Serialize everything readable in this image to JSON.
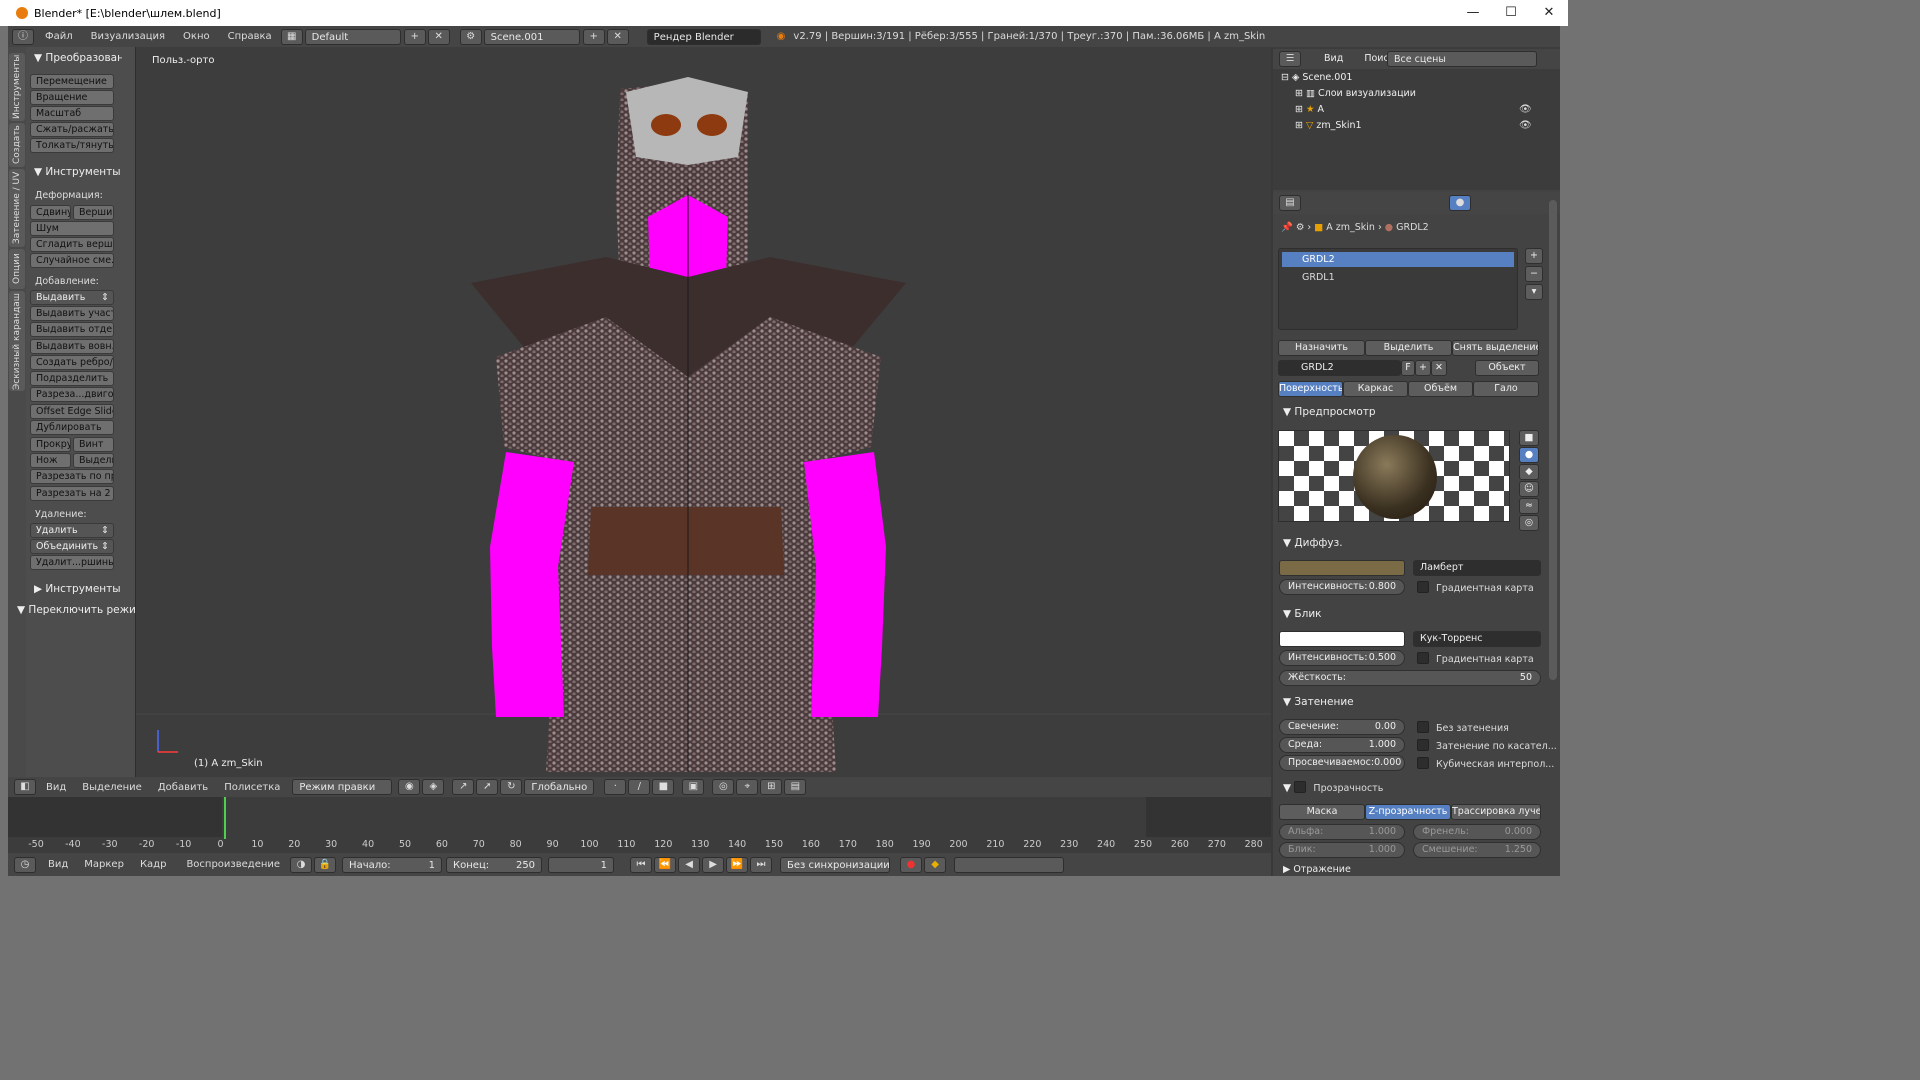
{
  "window": {
    "title": "Blender* [E:\\blender\\шлем.blend]",
    "buttons": [
      "—",
      "☐",
      "✕"
    ]
  },
  "topbar": {
    "menus": [
      "Файл",
      "Визуализация",
      "Окно",
      "Справка"
    ],
    "layout": "Default",
    "scene": "Scene.001",
    "engine": "Рендер Blender",
    "stats": "v2.79 | Вершин:3/191 | Рёбер:3/555 | Граней:1/370 | Треуг.:370 | Пам.:36.06МБ | A zm_Skin"
  },
  "vtabs": [
    "Инструменты",
    "Создать",
    "Затенение / UV",
    "Опции",
    "Эскизный карандаш"
  ],
  "toolshelf": {
    "transform_header": "Преобразовани",
    "transform": [
      "Перемещение",
      "Вращение",
      "Масштаб",
      "Сжать/расжать",
      "Толкать/тянуть"
    ],
    "mesh_tools_header": "Инструменты по",
    "deform_label": "Деформация:",
    "deform_row": [
      "Сдвину",
      "Вершин"
    ],
    "deform": [
      "Шум",
      "Сгладить верш...",
      "Случайное сме..."
    ],
    "add_label": "Добавление:",
    "extrude_dd": "Выдавить",
    "add": [
      "Выдавить участ...",
      "Выдавить отде...",
      "Выдавить вовн...",
      "Создать ребро/г...",
      "Подразделить",
      "Разреза...двигом",
      "Offset Edge Slide",
      "Дублировать"
    ],
    "row1": [
      "Прокру",
      "Винт"
    ],
    "row2": [
      "Нож",
      "Выдели"
    ],
    "cuts": [
      "Разрезать по пр...",
      "Разрезать на 2 ..."
    ],
    "remove_label": "Удаление:",
    "delete_dd": "Удалить",
    "merge_dd": "Объединить",
    "remove_doubles": "Удалит...ршины",
    "more_tools": "Инструменты ве",
    "toggle_mode": "Переключить режи п"
  },
  "viewport": {
    "view_label": "Польз.-орто",
    "object_label": "(1) A zm_Skin"
  },
  "viewport_footer": {
    "menus": [
      "Вид",
      "Выделение",
      "Добавить",
      "Полисетка"
    ],
    "mode": "Режим правки",
    "orientation": "Глобально"
  },
  "timeline": {
    "ticks": [
      "-50",
      "-40",
      "-30",
      "-20",
      "-10",
      "0",
      "10",
      "20",
      "30",
      "40",
      "50",
      "60",
      "70",
      "80",
      "90",
      "100",
      "110",
      "120",
      "130",
      "140",
      "150",
      "160",
      "170",
      "180",
      "190",
      "200",
      "210",
      "220",
      "230",
      "240",
      "250",
      "260",
      "270",
      "280"
    ],
    "current_frame": 1,
    "menus": [
      "Вид",
      "Маркер",
      "Кадр",
      "Воспроизведение"
    ],
    "start_label": "Начало:",
    "start": "1",
    "end_label": "Конец:",
    "end": "250",
    "frame": "1",
    "sync": "Без синхронизации"
  },
  "outliner": {
    "menus": [
      "Вид",
      "Поиск"
    ],
    "filter": "Все сцены",
    "rows": [
      "Scene.001",
      "Слои визуализации",
      "A",
      "zm_Skin1"
    ]
  },
  "properties": {
    "breadcrumb": [
      "A zm_Skin",
      "GRDL2"
    ],
    "slots": [
      "GRDL2",
      "GRDL1"
    ],
    "assign": "Назначить",
    "select": "Выделить",
    "deselect": "Снять выделение",
    "material_name": "GRDL2",
    "fake_user": "F",
    "link": "Объект",
    "tabs": [
      "Поверхность",
      "Каркас",
      "Объём",
      "Гало"
    ],
    "preview_header": "Предпросмотр",
    "diffuse_header": "Диффуз.",
    "diffuse_color": "#7a6a45",
    "diffuse_shader": "Ламберт",
    "intensity_label": "Интенсивность:",
    "diffuse_intensity": "0.800",
    "ramp_label": "Градиентная карта",
    "specular_header": "Блик",
    "specular_shader": "Кук-Торренс",
    "specular_intensity": "0.500",
    "hardness_label": "Жёсткость:",
    "hardness": "50",
    "shading_header": "Затенение",
    "emit_label": "Свечение:",
    "emit": "0.00",
    "ambient_label": "Среда:",
    "ambient": "1.000",
    "translucency_label": "Просвечиваемос:",
    "translucency": "0.000",
    "shadeless": "Без затенения",
    "tangent": "Затенение по касател...",
    "cubic": "Кубическая интерпол...",
    "transparency_header": "Прозрачность",
    "transp_tabs": [
      "Маска",
      "Z-прозрачность",
      "Трассировка лучей"
    ],
    "alpha_label": "Альфа:",
    "alpha": "1.000",
    "fresnel_label": "Френель:",
    "fresnel": "0.000",
    "spec_label": "Блик:",
    "spec": "1.000",
    "blend_label": "Смешение:",
    "blend": "1.250",
    "mirror_header": "Отражение"
  }
}
